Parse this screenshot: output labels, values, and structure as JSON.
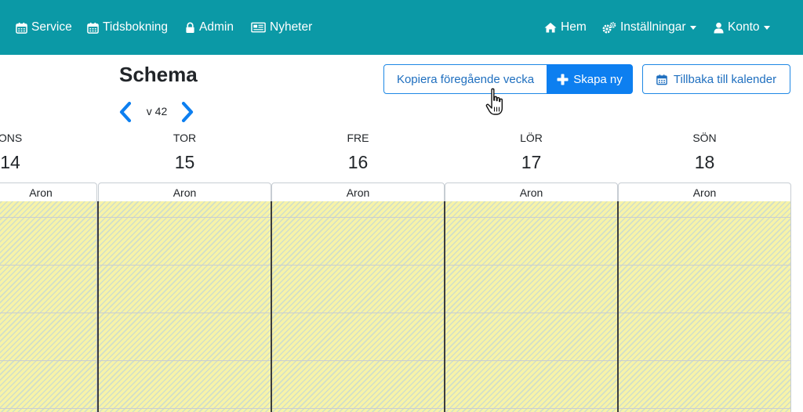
{
  "navbar": {
    "left_items": [
      {
        "label": "Service",
        "icon": "calendar-icon"
      },
      {
        "label": "Tidsbokning",
        "icon": "calendar-icon"
      },
      {
        "label": "Admin",
        "icon": "lock-icon"
      },
      {
        "label": "Nyheter",
        "icon": "newspaper-icon"
      }
    ],
    "right_items": [
      {
        "label": "Hem",
        "icon": "home-icon"
      },
      {
        "label": "Inställningar",
        "icon": "gears-icon",
        "dropdown": true
      },
      {
        "label": "Konto",
        "icon": "user-icon",
        "dropdown": true
      }
    ]
  },
  "schedule": {
    "title": "Schema",
    "week_label": "v 42"
  },
  "toolbar": {
    "copy_label": "Kopiera föregående vecka",
    "create_label": "Skapa ny",
    "back_label": "Tillbaka till kalender"
  },
  "days": [
    {
      "name": "ONS",
      "number": "14",
      "resource": "Aron"
    },
    {
      "name": "TOR",
      "number": "15",
      "resource": "Aron"
    },
    {
      "name": "FRE",
      "number": "16",
      "resource": "Aron"
    },
    {
      "name": "LÖR",
      "number": "17",
      "resource": "Aron"
    },
    {
      "name": "SÖN",
      "number": "18",
      "resource": "Aron"
    }
  ],
  "colors": {
    "navbar": "#0b99a6",
    "primary": "#0d7ff0",
    "slot_background": "#f7f3a8",
    "slot_stripes": "#afcde6"
  }
}
